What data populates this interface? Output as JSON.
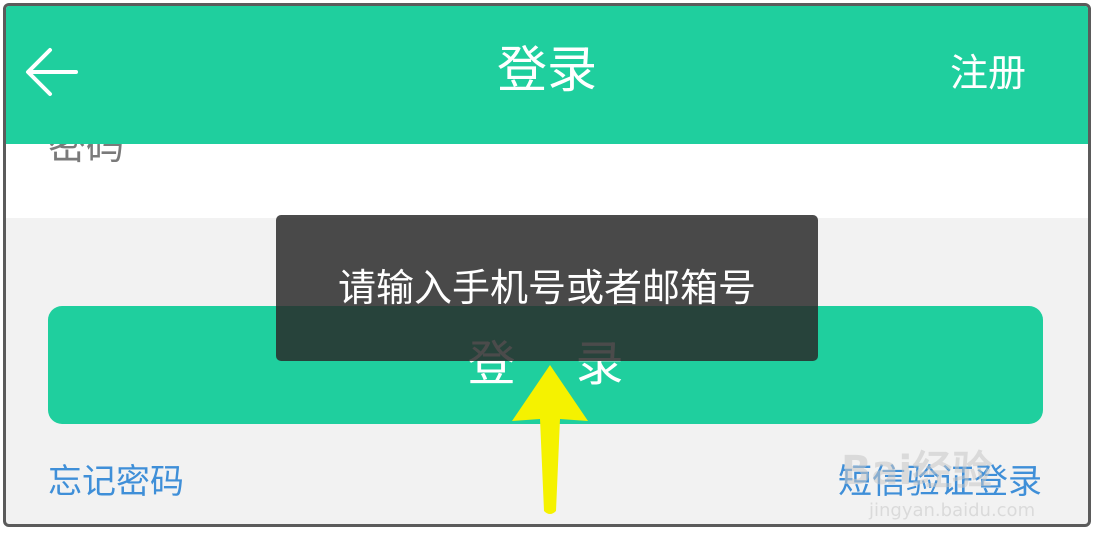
{
  "header": {
    "title": "登录",
    "register_label": "注册"
  },
  "form": {
    "password_label": "密码"
  },
  "login_button": {
    "label": "登录"
  },
  "links": {
    "forgot_password": "忘记密码",
    "sms_login": "短信验证登录"
  },
  "toast": {
    "message": "请输入手机号或者邮箱号"
  },
  "watermark": {
    "text": "Bai经验",
    "sub": "jingyan.baidu.com"
  },
  "colors": {
    "accent": "#1fcf9e",
    "link": "#3f8fd8",
    "arrow": "#f5f200"
  }
}
